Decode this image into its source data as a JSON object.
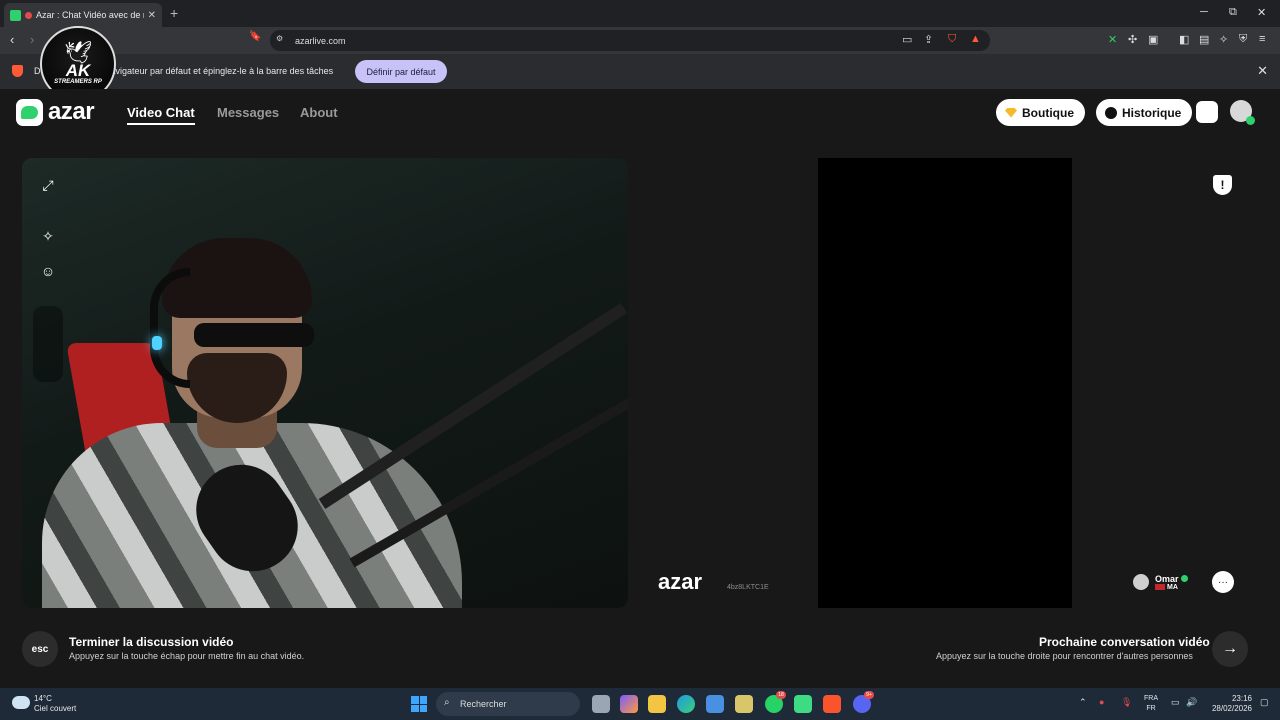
{
  "browser": {
    "tab_title": "Azar : Chat Vidéo avec de no",
    "tab_close": "✕",
    "new_tab": "+",
    "url": "azarlive.com",
    "win_min": "─",
    "win_max": "⧉",
    "win_close": "✕"
  },
  "banner": {
    "text_prefix": "D",
    "text": "me navigateur par défaut et épinglez-le à la barre des tâches",
    "button": "Définir par défaut",
    "close": "✕"
  },
  "overlay_logo": {
    "wings": "🕊",
    "name": "AK",
    "sub": "STREAMERS RP"
  },
  "site": {
    "logo_text": "azar",
    "nav": [
      "Video Chat",
      "Messages",
      "About"
    ],
    "shop_label": "Boutique",
    "history_label": "Historique"
  },
  "video": {
    "watermark": "azar",
    "watermark_id": "4bz8LKTC1E",
    "peer_name": "Omar",
    "peer_country": "MA",
    "report_icon": "!"
  },
  "footer": {
    "esc_key": "esc",
    "end_title": "Terminer la discussion vidéo",
    "end_sub": "Appuyez sur la touche échap pour mettre fin au chat vidéo.",
    "next_title": "Prochaine conversation vidéo",
    "next_sub": "Appuyez sur la touche droite pour rencontrer d'autres personnes",
    "next_arrow": "→"
  },
  "taskbar": {
    "temp": "14°C",
    "weather": "Ciel couvert",
    "search": "Rechercher",
    "lang_top": "FRA",
    "lang_bottom": "FR",
    "time": "23:16",
    "date": "28/02/2026",
    "badge_whatsapp": "18",
    "badge_discord": "9+"
  },
  "colors": {
    "accent_green": "#2ed16b",
    "banner_button": "#c7c3f8"
  }
}
